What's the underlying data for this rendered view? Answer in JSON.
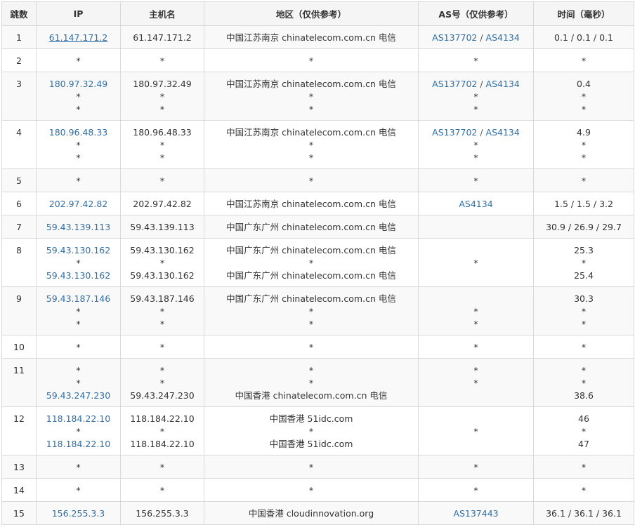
{
  "headers": [
    "跳数",
    "IP",
    "主机名",
    "地区（仅供参考）",
    "AS号（仅供参考）",
    "时间（毫秒）"
  ],
  "rows": [
    {
      "hop": "1",
      "ip": [
        "61.147.171.2"
      ],
      "host": [
        "61.147.171.2"
      ],
      "region": [
        "中国江苏南京 chinatelecom.com.cn 电信"
      ],
      "as": [
        [
          "AS137702",
          "AS4134"
        ]
      ],
      "time": [
        "0.1 / 0.1 / 0.1"
      ]
    },
    {
      "hop": "2",
      "ip": [
        "*"
      ],
      "host": [
        "*"
      ],
      "region": [
        "*"
      ],
      "as": [
        [
          "*"
        ]
      ],
      "time": [
        "*"
      ]
    },
    {
      "hop": "3",
      "ip": [
        "180.97.32.49",
        "*",
        "*"
      ],
      "host": [
        "180.97.32.49",
        "*",
        "*"
      ],
      "region": [
        "中国江苏南京 chinatelecom.com.cn 电信",
        "*",
        "*"
      ],
      "as": [
        [
          "AS137702",
          "AS4134"
        ],
        [
          "*"
        ],
        [
          "*"
        ]
      ],
      "time": [
        "0.4",
        "*",
        "*"
      ]
    },
    {
      "hop": "4",
      "ip": [
        "180.96.48.33",
        "*",
        "*"
      ],
      "host": [
        "180.96.48.33",
        "*",
        "*"
      ],
      "region": [
        "中国江苏南京 chinatelecom.com.cn 电信",
        "*",
        "*"
      ],
      "as": [
        [
          "AS137702",
          "AS4134"
        ],
        [
          "*"
        ],
        [
          "*"
        ]
      ],
      "time": [
        "4.9",
        "*",
        "*"
      ]
    },
    {
      "hop": "5",
      "ip": [
        "*"
      ],
      "host": [
        "*"
      ],
      "region": [
        "*"
      ],
      "as": [
        [
          "*"
        ]
      ],
      "time": [
        "*"
      ]
    },
    {
      "hop": "6",
      "ip": [
        "202.97.42.82"
      ],
      "host": [
        "202.97.42.82"
      ],
      "region": [
        "中国江苏南京 chinatelecom.com.cn 电信"
      ],
      "as": [
        [
          "AS4134"
        ]
      ],
      "time": [
        "1.5 / 1.5 / 3.2"
      ]
    },
    {
      "hop": "7",
      "ip": [
        "59.43.139.113"
      ],
      "host": [
        "59.43.139.113"
      ],
      "region": [
        "中国广东广州 chinatelecom.com.cn 电信"
      ],
      "as": [
        [
          ""
        ]
      ],
      "time": [
        "30.9 / 26.9 / 29.7"
      ]
    },
    {
      "hop": "8",
      "ip": [
        "59.43.130.162",
        "*",
        "59.43.130.162"
      ],
      "host": [
        "59.43.130.162",
        "*",
        "59.43.130.162"
      ],
      "region": [
        "中国广东广州 chinatelecom.com.cn 电信",
        "*",
        "中国广东广州 chinatelecom.com.cn 电信"
      ],
      "as": [
        [
          ""
        ],
        [
          "*"
        ],
        [
          ""
        ]
      ],
      "time": [
        "25.3",
        "*",
        "25.4"
      ]
    },
    {
      "hop": "9",
      "ip": [
        "59.43.187.146",
        "*",
        "*"
      ],
      "host": [
        "59.43.187.146",
        "*",
        "*"
      ],
      "region": [
        "中国广东广州 chinatelecom.com.cn 电信",
        "*",
        "*"
      ],
      "as": [
        [
          ""
        ],
        [
          "*"
        ],
        [
          "*"
        ]
      ],
      "time": [
        "30.3",
        "*",
        "*"
      ]
    },
    {
      "hop": "10",
      "ip": [
        "*"
      ],
      "host": [
        "*"
      ],
      "region": [
        "*"
      ],
      "as": [
        [
          "*"
        ]
      ],
      "time": [
        "*"
      ]
    },
    {
      "hop": "11",
      "ip": [
        "*",
        "*",
        "59.43.247.230"
      ],
      "host": [
        "*",
        "*",
        "59.43.247.230"
      ],
      "region": [
        "*",
        "*",
        "中国香港 chinatelecom.com.cn 电信"
      ],
      "as": [
        [
          "*"
        ],
        [
          "*"
        ],
        [
          ""
        ]
      ],
      "time": [
        "*",
        "*",
        "38.6"
      ]
    },
    {
      "hop": "12",
      "ip": [
        "118.184.22.10",
        "*",
        "118.184.22.10"
      ],
      "host": [
        "118.184.22.10",
        "*",
        "118.184.22.10"
      ],
      "region": [
        "中国香港 51idc.com",
        "*",
        "中国香港 51idc.com"
      ],
      "as": [
        [
          ""
        ],
        [
          "*"
        ],
        [
          ""
        ]
      ],
      "time": [
        "46",
        "*",
        "47"
      ]
    },
    {
      "hop": "13",
      "ip": [
        "*"
      ],
      "host": [
        "*"
      ],
      "region": [
        "*"
      ],
      "as": [
        [
          "*"
        ]
      ],
      "time": [
        "*"
      ]
    },
    {
      "hop": "14",
      "ip": [
        "*"
      ],
      "host": [
        "*"
      ],
      "region": [
        "*"
      ],
      "as": [
        [
          "*"
        ]
      ],
      "time": [
        "*"
      ]
    },
    {
      "hop": "15",
      "ip": [
        "156.255.3.3"
      ],
      "host": [
        "156.255.3.3"
      ],
      "region": [
        "中国香港 cloudinnovation.org"
      ],
      "as": [
        [
          "AS137443"
        ]
      ],
      "time": [
        "36.1 / 36.1 / 36.1"
      ]
    }
  ],
  "colors": {
    "link": "#2f6fa8",
    "header_bg": "#f5f5f5",
    "alt_row_bg": "#f9f9f9",
    "border": "#d9d9d9"
  }
}
